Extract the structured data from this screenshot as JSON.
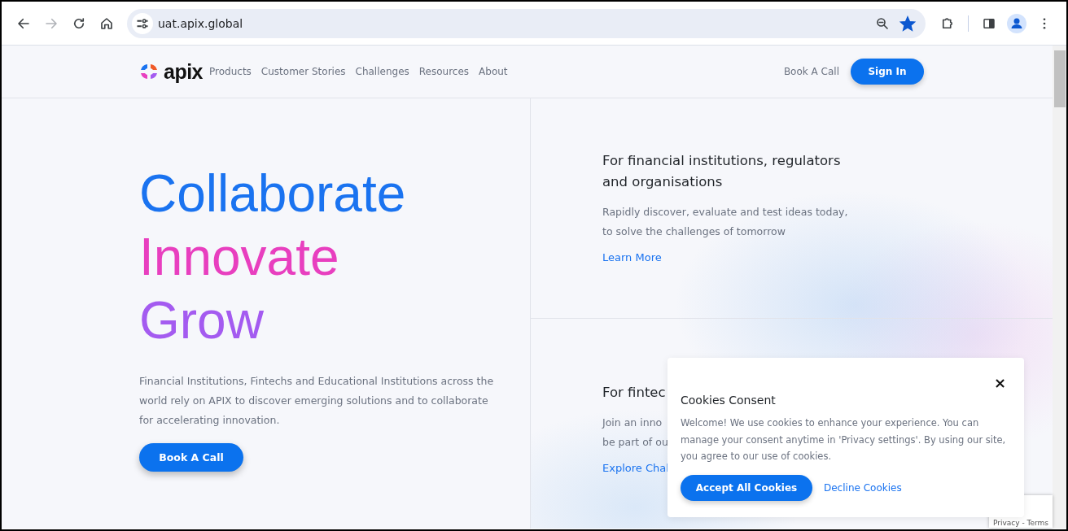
{
  "browser": {
    "url": "uat.apix.global",
    "back_disabled": false,
    "forward_disabled": true,
    "bookmarked": true
  },
  "nav": {
    "logo_text": "apix",
    "links": [
      "Products",
      "Customer Stories",
      "Challenges",
      "Resources",
      "About"
    ],
    "book_call": "Book A Call",
    "sign_in": "Sign In"
  },
  "hero": {
    "lines": [
      {
        "text": "Collaborate",
        "color": "#1a73f0"
      },
      {
        "text": "Innovate",
        "color": "#e83fbf"
      },
      {
        "text": "Grow",
        "color": "#a45bf0"
      }
    ],
    "description": "Financial Institutions, Fintechs and Educational Institutions across the world rely on APIX to discover emerging solutions and to collaborate for accelerating innovation.",
    "button": "Book A Call"
  },
  "cards": [
    {
      "title": "For financial institutions, regulators and organisations",
      "body": [
        "Rapidly discover, evaluate and test ideas today,",
        "to solve the challenges of tomorrow"
      ],
      "link": "Learn More"
    },
    {
      "title": "For fintec",
      "body": [
        "Join an inno",
        "be part of ou"
      ],
      "link": "Explore Chal"
    }
  ],
  "cookies": {
    "title": "Cookies Consent",
    "text": "Welcome! We use cookies to enhance your experience. You can manage your consent anytime in 'Privacy settings'. By using our site, you agree to our use of cookies.",
    "close": "×",
    "accept": "Accept All Cookies",
    "decline": "Decline Cookies"
  },
  "recaptcha": {
    "text": "Privacy - Terms"
  }
}
